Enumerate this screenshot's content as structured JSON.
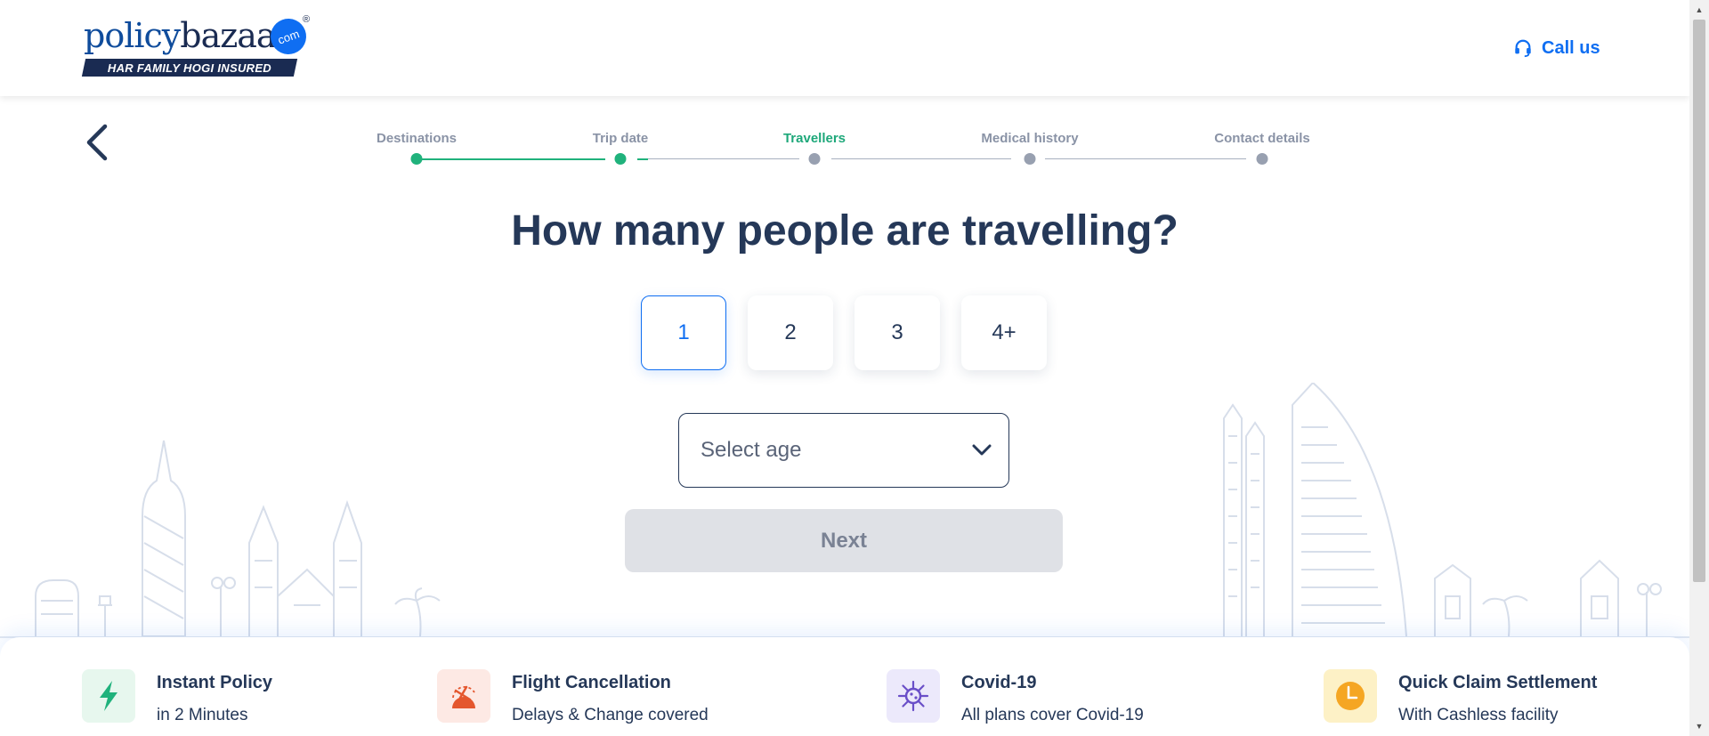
{
  "header": {
    "logo_word_1": "policy",
    "logo_word_2": "bazaar",
    "logo_com": "com",
    "logo_reg": "®",
    "logo_tagline": "HAR FAMILY HOGI INSURED",
    "call_label": "Call us"
  },
  "stepper": {
    "steps": [
      {
        "label": "Destinations"
      },
      {
        "label": "Trip date"
      },
      {
        "label": "Travellers"
      },
      {
        "label": "Medical history"
      },
      {
        "label": "Contact details"
      }
    ],
    "active_index": 2
  },
  "title": "How many people are travelling?",
  "counts": {
    "options": [
      "1",
      "2",
      "3",
      "4+"
    ],
    "selected": "1"
  },
  "age_select": {
    "placeholder": "Select age"
  },
  "next_label": "Next",
  "features": [
    {
      "title": "Instant Policy",
      "subtitle": "in 2 Minutes",
      "icon": "lightning-icon",
      "bg": "#e7f7ee",
      "color": "#20b27c"
    },
    {
      "title": "Flight Cancellation",
      "subtitle": "Delays & Change covered",
      "icon": "flight-cancel-icon",
      "bg": "#fde9e4",
      "color": "#e4572e"
    },
    {
      "title": "Covid-19",
      "subtitle": "All plans cover Covid-19",
      "icon": "virus-icon",
      "bg": "#ece9fb",
      "color": "#6a4fc8"
    },
    {
      "title": "Quick Claim Settlement",
      "subtitle": "With Cashless facility",
      "icon": "clock-icon",
      "bg": "#fdf1c6",
      "color": "#f5a623"
    }
  ],
  "colors": {
    "brand_blue": "#0f6ef2",
    "navy": "#253858",
    "green": "#20b27c"
  }
}
